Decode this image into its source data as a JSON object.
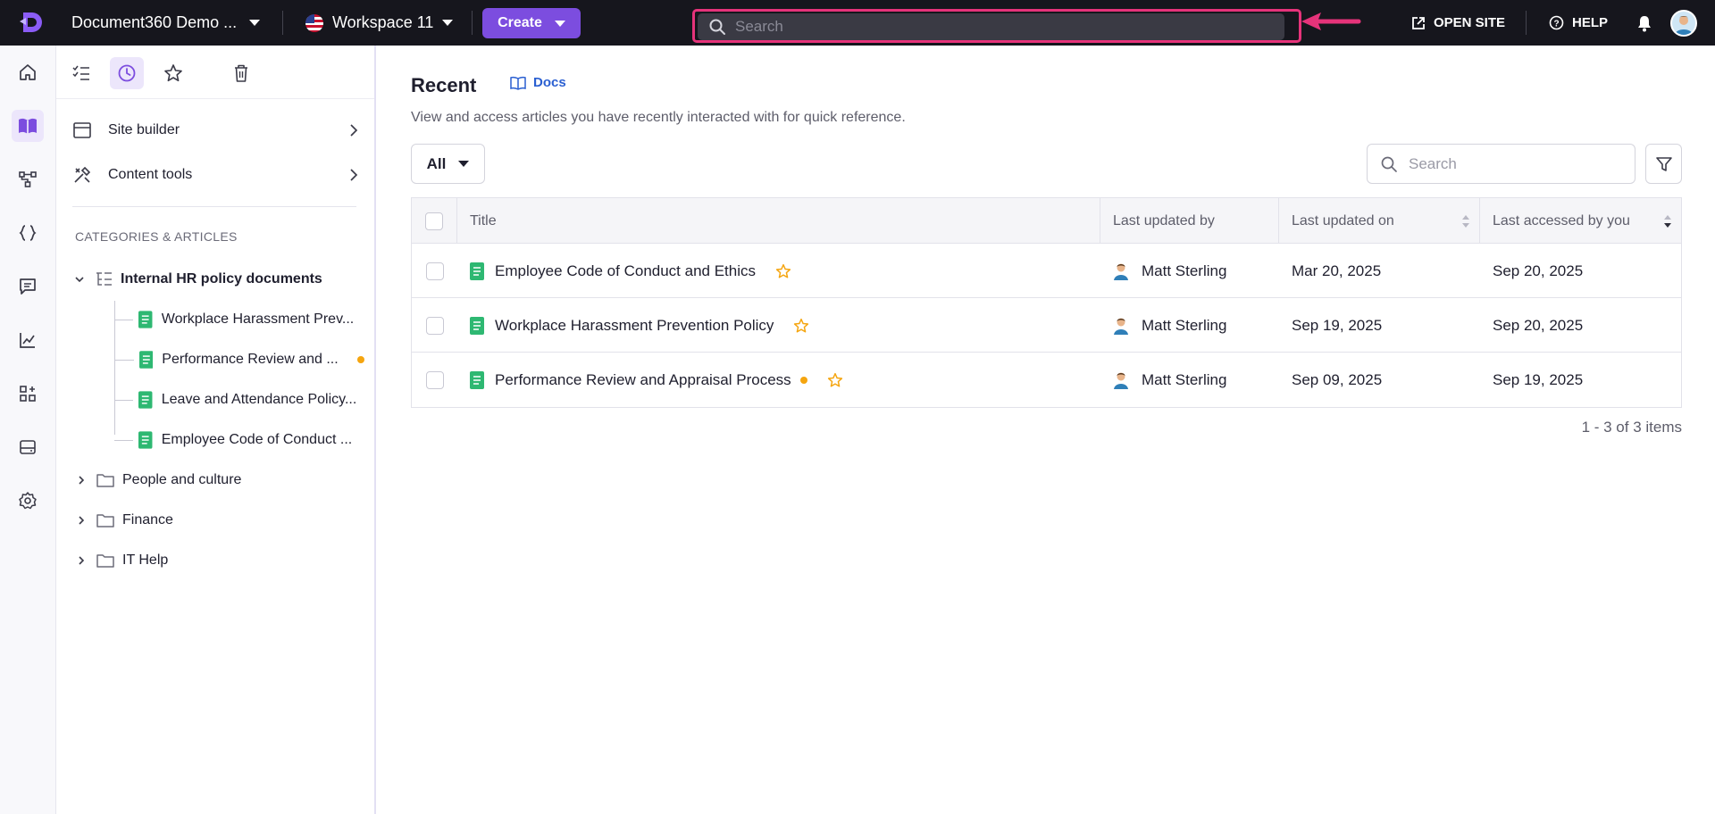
{
  "topbar": {
    "project_name": "Document360 Demo ...",
    "workspace": "Workspace 11",
    "create_label": "Create",
    "search_placeholder": "Search",
    "open_site_label": "OPEN SITE",
    "help_label": "HELP"
  },
  "rail": {
    "items": [
      "home-icon",
      "docs-book-icon",
      "workflow-icon",
      "api-braces-icon",
      "feedback-icon",
      "analytics-icon",
      "widgets-icon",
      "drive-icon",
      "settings-icon"
    ],
    "active": "docs-book-icon"
  },
  "sidebar": {
    "tabs": [
      "all-articles-icon",
      "recent-icon",
      "starred-icon",
      "recycle-bin-icon"
    ],
    "active_tab": "recent-icon",
    "site_builder": "Site builder",
    "content_tools": "Content tools",
    "section_heading": "CATEGORIES & ARTICLES",
    "tree": {
      "category": "Internal HR policy documents",
      "articles": [
        {
          "title": "Workplace Harassment Prev...",
          "dot": false
        },
        {
          "title": "Performance Review and ...",
          "dot": true
        },
        {
          "title": "Leave and Attendance Policy...",
          "dot": false
        },
        {
          "title": "Employee Code of Conduct ...",
          "dot": false
        }
      ],
      "folders": [
        "People and culture",
        "Finance",
        "IT Help"
      ]
    }
  },
  "main": {
    "title": "Recent",
    "docs_link": "Docs",
    "description": "View and access articles you have recently interacted with for quick reference.",
    "filter_value": "All",
    "search_placeholder": "Search",
    "columns": [
      "Title",
      "Last updated by",
      "Last updated on",
      "Last accessed by you"
    ],
    "rows": [
      {
        "title": "Employee Code of Conduct and Ethics",
        "dot": false,
        "updated_by": "Matt Sterling",
        "updated_on": "Mar 20, 2025",
        "accessed": "Sep 20, 2025"
      },
      {
        "title": "Workplace Harassment Prevention Policy",
        "dot": false,
        "updated_by": "Matt Sterling",
        "updated_on": "Sep 19, 2025",
        "accessed": "Sep 20, 2025"
      },
      {
        "title": "Performance Review and Appraisal Process",
        "dot": true,
        "updated_by": "Matt Sterling",
        "updated_on": "Sep 09, 2025",
        "accessed": "Sep 19, 2025"
      }
    ],
    "pagination": "1 - 3 of 3 items"
  },
  "colors": {
    "accent": "#7c4ddf",
    "highlight": "#e6337a",
    "article_icon": "#2eb872",
    "star": "#f5a50f",
    "link": "#2a5fd1"
  }
}
